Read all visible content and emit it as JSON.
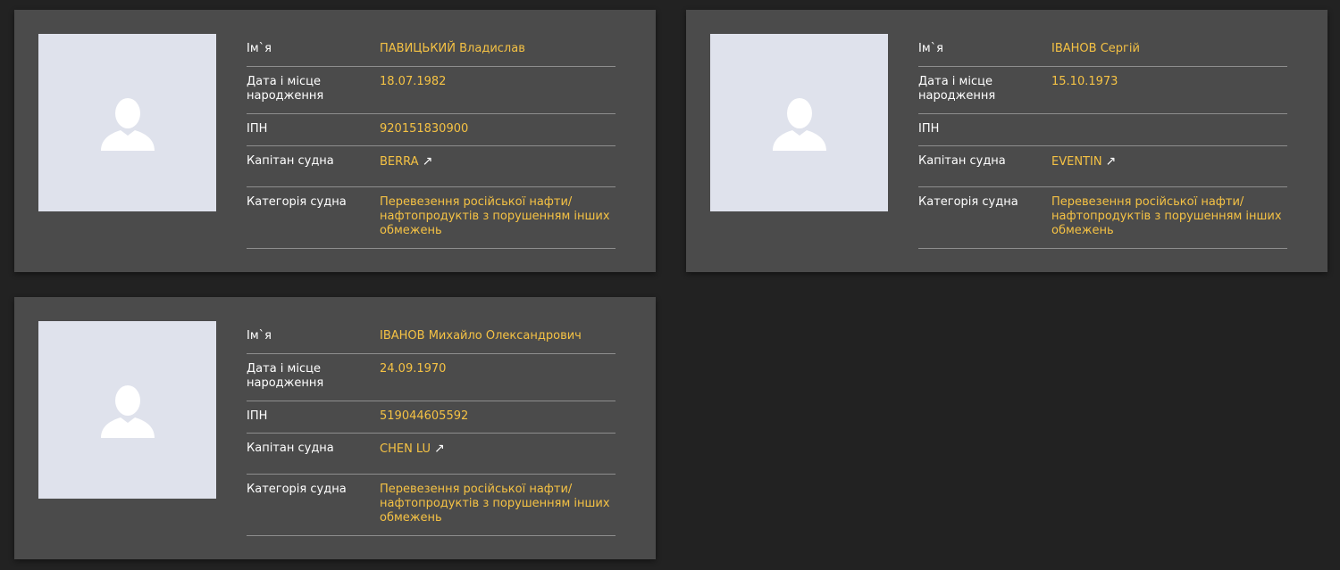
{
  "labels": {
    "name": "Ім`я",
    "birth": "Дата і місце народження",
    "inn": "ІПН",
    "captain": "Капітан судна",
    "category": "Категорія судна"
  },
  "icons": {
    "avatar": "person-silhouette-icon",
    "external_link": "arrow-up-right-icon",
    "external_link_glyph": "↗"
  },
  "colors": {
    "page_bg": "#222222",
    "card_bg": "#4b4b4b",
    "photo_bg": "#dfe2ec",
    "value_accent": "#f5c244",
    "divider": "#8e8e8e"
  },
  "cards": [
    {
      "name": "ПАВИЦЬКИЙ Владислав",
      "birth": "18.07.1982",
      "inn": "920151830900",
      "vessel": "BERRA",
      "category": "Перевезення російської нафти/нафтопродуктів з порушенням інших обмежень"
    },
    {
      "name": "ІВАНОВ Сергій",
      "birth": "15.10.1973",
      "inn": "",
      "vessel": "EVENTIN",
      "category": "Перевезення російської нафти/нафтопродуктів з порушенням інших обмежень"
    },
    {
      "name": "ІВАНОВ Михайло Олександрович",
      "birth": "24.09.1970",
      "inn": "519044605592",
      "vessel": "CHEN LU",
      "category": "Перевезення російської нафти/нафтопродуктів з порушенням інших обмежень"
    }
  ]
}
